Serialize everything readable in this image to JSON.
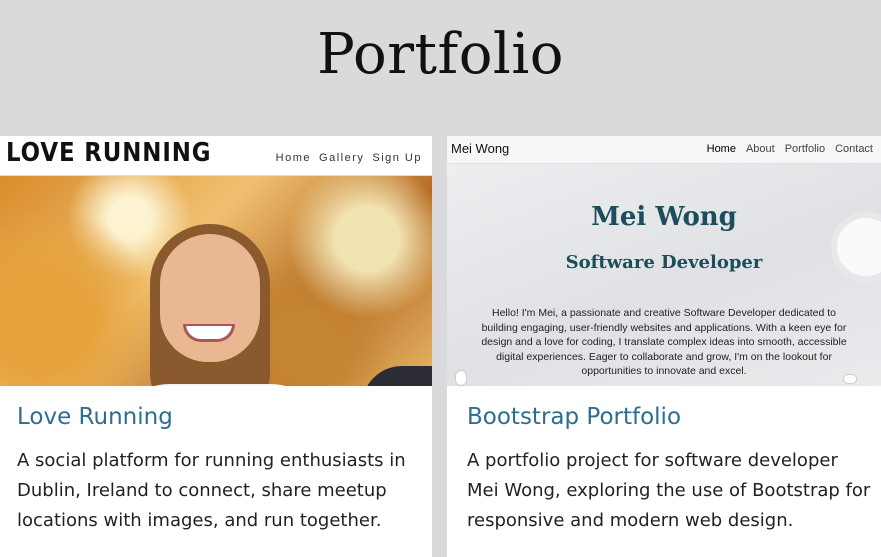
{
  "page": {
    "title": "Portfolio"
  },
  "projects": [
    {
      "title": "Love Running",
      "description": "A social platform for running enthusiasts in Dublin, Ireland to connect, share meetup locations with images, and run together.",
      "thumbnail": {
        "logo": "LOVE RUNNING",
        "nav": [
          "Home",
          "Gallery",
          "Sign Up"
        ]
      }
    },
    {
      "title": "Bootstrap Portfolio",
      "description": "A portfolio project for software developer Mei Wong, exploring the use of Bootstrap for responsive and modern web design.",
      "thumbnail": {
        "brand": "Mei Wong",
        "nav": [
          "Home",
          "About",
          "Portfolio",
          "Contact"
        ],
        "hero_name": "Mei Wong",
        "hero_role": "Software Developer",
        "hero_bio": "Hello! I'm Mei, a passionate and creative Software Developer dedicated to building engaging, user-friendly websites and applications. With a keen eye for design and a love for coding, I translate complex ideas into smooth, accessible digital experiences. Eager to collaborate and grow, I'm on the lookout for opportunities to innovate and excel."
      }
    }
  ],
  "colors": {
    "page_background": "#dadadc",
    "card_title": "#2b6e8f",
    "hero_heading": "#1b4d5a"
  }
}
